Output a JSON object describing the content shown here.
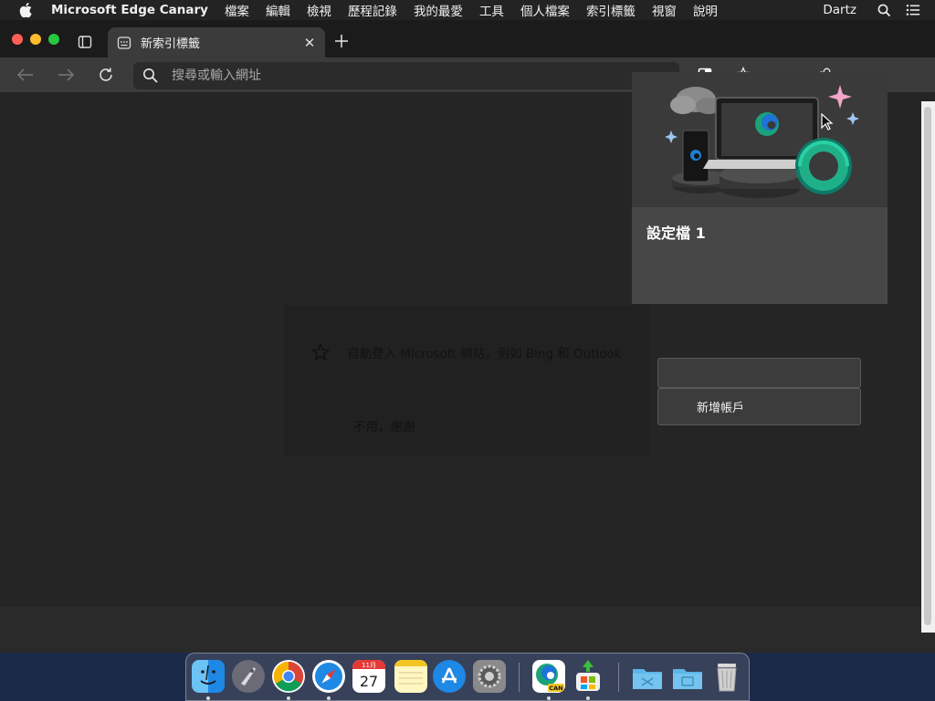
{
  "menubar": {
    "app_name": "Microsoft Edge Canary",
    "menus": [
      "檔案",
      "編輯",
      "檢視",
      "歷程記錄",
      "我的最愛",
      "工具",
      "個人檔案",
      "索引標籤",
      "視窗",
      "說明"
    ],
    "user": "Dartz",
    "icons": [
      "apple-icon",
      "spotlight-search-icon",
      "control-center-icon"
    ]
  },
  "tab": {
    "title": "新索引標籤",
    "close": "✕",
    "new_tab": "+"
  },
  "address_bar": {
    "placeholder": "搜尋或輸入網址",
    "value": ""
  },
  "toolbar_icons": [
    "back-icon",
    "forward-icon",
    "refresh-icon",
    "split-screen-icon",
    "favorites-icon",
    "profile-icon"
  ],
  "profile_flyout": {
    "name": "設定檔 1",
    "add_account_label": "新增帳戶"
  },
  "signin_dialog": {
    "sync_text": "自動登入 Microsoft 網站，例如 Bing 和 Outlook",
    "decline_label": "不用，謝謝"
  },
  "dock": {
    "apps": [
      {
        "name": "Finder",
        "icon": "finder-icon"
      },
      {
        "name": "Launchpad",
        "icon": "launchpad-icon"
      },
      {
        "name": "Google Chrome",
        "icon": "chrome-icon"
      },
      {
        "name": "Safari",
        "icon": "safari-icon"
      },
      {
        "name": "Calendar",
        "icon": "calendar-icon",
        "label": "27",
        "month": "11月"
      },
      {
        "name": "Notes",
        "icon": "notes-icon"
      },
      {
        "name": "App Store",
        "icon": "app-store-icon"
      },
      {
        "name": "System Preferences",
        "icon": "system-preferences-icon"
      },
      {
        "name": "Microsoft Edge Canary",
        "icon": "edge-canary-icon",
        "badge": "CAN"
      },
      {
        "name": "Microsoft Installer",
        "icon": "installer-icon"
      },
      {
        "name": "Folder",
        "icon": "folder-icon"
      },
      {
        "name": "Folder",
        "icon": "folder-icon"
      },
      {
        "name": "Trash",
        "icon": "trash-icon"
      }
    ]
  },
  "colors": {
    "menubar_bg": "#232323",
    "tab_active": "#3b3b3b",
    "toolbar_bg": "#3b3b3b",
    "content_bg": "#252525",
    "flyout_bg": "#474747",
    "edge_teal": "#1fa67a",
    "edge_blue": "#0f6cbd"
  }
}
